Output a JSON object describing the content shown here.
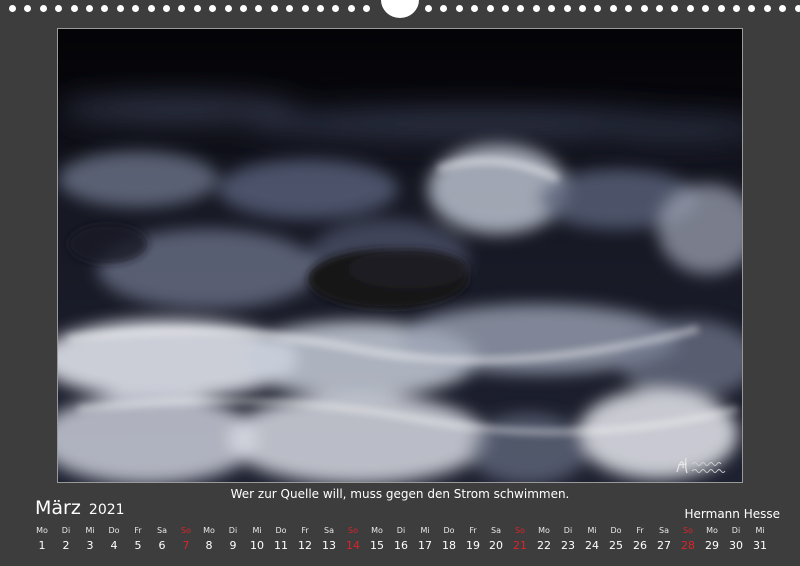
{
  "calendar": {
    "month": "März",
    "year": "2021",
    "quote": "Wer zur Quelle will, muss gegen den Strom schwimmen.",
    "author": "Hermann Hesse",
    "signature_icon": "handwritten-signature",
    "sunday_color": "#d9252a",
    "days": [
      {
        "wd": "Mo",
        "n": "1"
      },
      {
        "wd": "Di",
        "n": "2"
      },
      {
        "wd": "Mi",
        "n": "3"
      },
      {
        "wd": "Do",
        "n": "4"
      },
      {
        "wd": "Fr",
        "n": "5"
      },
      {
        "wd": "Sa",
        "n": "6"
      },
      {
        "wd": "So",
        "n": "7"
      },
      {
        "wd": "Mo",
        "n": "8"
      },
      {
        "wd": "Di",
        "n": "9"
      },
      {
        "wd": "Mi",
        "n": "10"
      },
      {
        "wd": "Do",
        "n": "11"
      },
      {
        "wd": "Fr",
        "n": "12"
      },
      {
        "wd": "Sa",
        "n": "13"
      },
      {
        "wd": "So",
        "n": "14"
      },
      {
        "wd": "Mo",
        "n": "15"
      },
      {
        "wd": "Di",
        "n": "16"
      },
      {
        "wd": "Mi",
        "n": "17"
      },
      {
        "wd": "Do",
        "n": "18"
      },
      {
        "wd": "Fr",
        "n": "19"
      },
      {
        "wd": "Sa",
        "n": "20"
      },
      {
        "wd": "So",
        "n": "21"
      },
      {
        "wd": "Mo",
        "n": "22"
      },
      {
        "wd": "Di",
        "n": "23"
      },
      {
        "wd": "Mi",
        "n": "24"
      },
      {
        "wd": "Do",
        "n": "25"
      },
      {
        "wd": "Fr",
        "n": "26"
      },
      {
        "wd": "Sa",
        "n": "27"
      },
      {
        "wd": "So",
        "n": "28"
      },
      {
        "wd": "Mo",
        "n": "29"
      },
      {
        "wd": "Di",
        "n": "30"
      },
      {
        "wd": "Mi",
        "n": "31"
      }
    ]
  }
}
